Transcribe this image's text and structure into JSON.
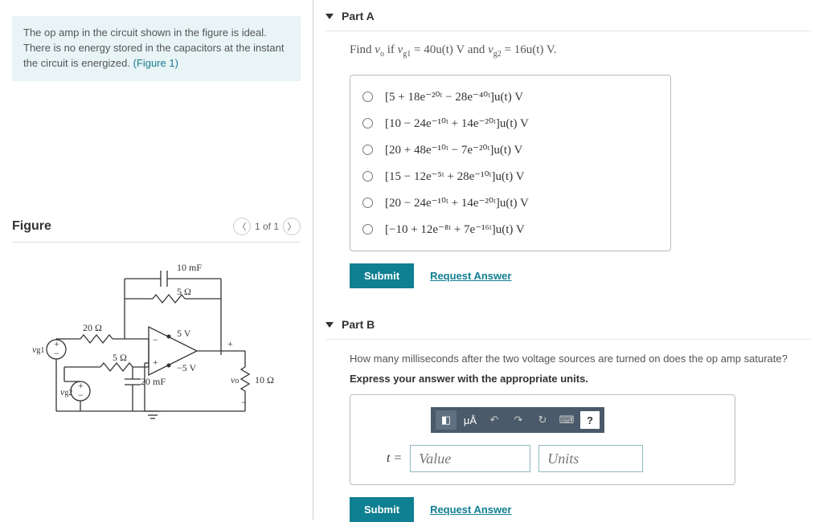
{
  "problem": {
    "text1": "The op amp in the circuit shown in the figure is ideal. There is no energy stored in the capacitors at the instant the circuit is energized. ",
    "fig_link": "(Figure 1)"
  },
  "figure": {
    "title": "Figure",
    "pager": "1 of 1",
    "labels": {
      "c1": "10 mF",
      "r1": "5 Ω",
      "r2": "20 Ω",
      "r3": "5 Ω",
      "c2": "20 mF",
      "vplus": "5 V",
      "vminus": "−5 V",
      "rload": "10 Ω",
      "vg1": "v",
      "vg1s": "g1",
      "vg2": "v",
      "vg2s": "g2",
      "vo": "v",
      "vos": "o"
    }
  },
  "partA": {
    "title": "Part A",
    "question_prefix": "Find ",
    "question_mid": " if ",
    "question_and": " V and ",
    "question_end": " V.",
    "vo": "v",
    "vo_s": "o",
    "vg1": "v",
    "vg1s": "g1",
    "eq1": " = 40u(t)",
    "vg2": "v",
    "vg2s": "g2",
    "eq2": " = 16u(t)",
    "options": [
      "[5 + 18e⁻²⁰ᵗ − 28e⁻⁴⁰ᵗ]u(t) V",
      "[10 − 24e⁻¹⁰ᵗ + 14e⁻²⁰ᵗ]u(t) V",
      "[20 + 48e⁻¹⁰ᵗ − 7e⁻²⁰ᵗ]u(t) V",
      "[15 − 12e⁻⁵ᵗ + 28e⁻¹⁰ᵗ]u(t) V",
      "[20 − 24e⁻¹⁰ᵗ + 14e⁻²⁰ᵗ]u(t) V",
      "[−10 + 12e⁻⁸ᵗ + 7e⁻¹⁶ᵗ]u(t) V"
    ],
    "submit": "Submit",
    "request": "Request Answer"
  },
  "partB": {
    "title": "Part B",
    "question": "How many milliseconds after the two voltage sources are turned on does the op amp saturate?",
    "instruction": "Express your answer with the appropriate units.",
    "var": "t =",
    "value_ph": "Value",
    "units_ph": "Units",
    "submit": "Submit",
    "request": "Request Answer",
    "tool_ua": "μÅ"
  }
}
